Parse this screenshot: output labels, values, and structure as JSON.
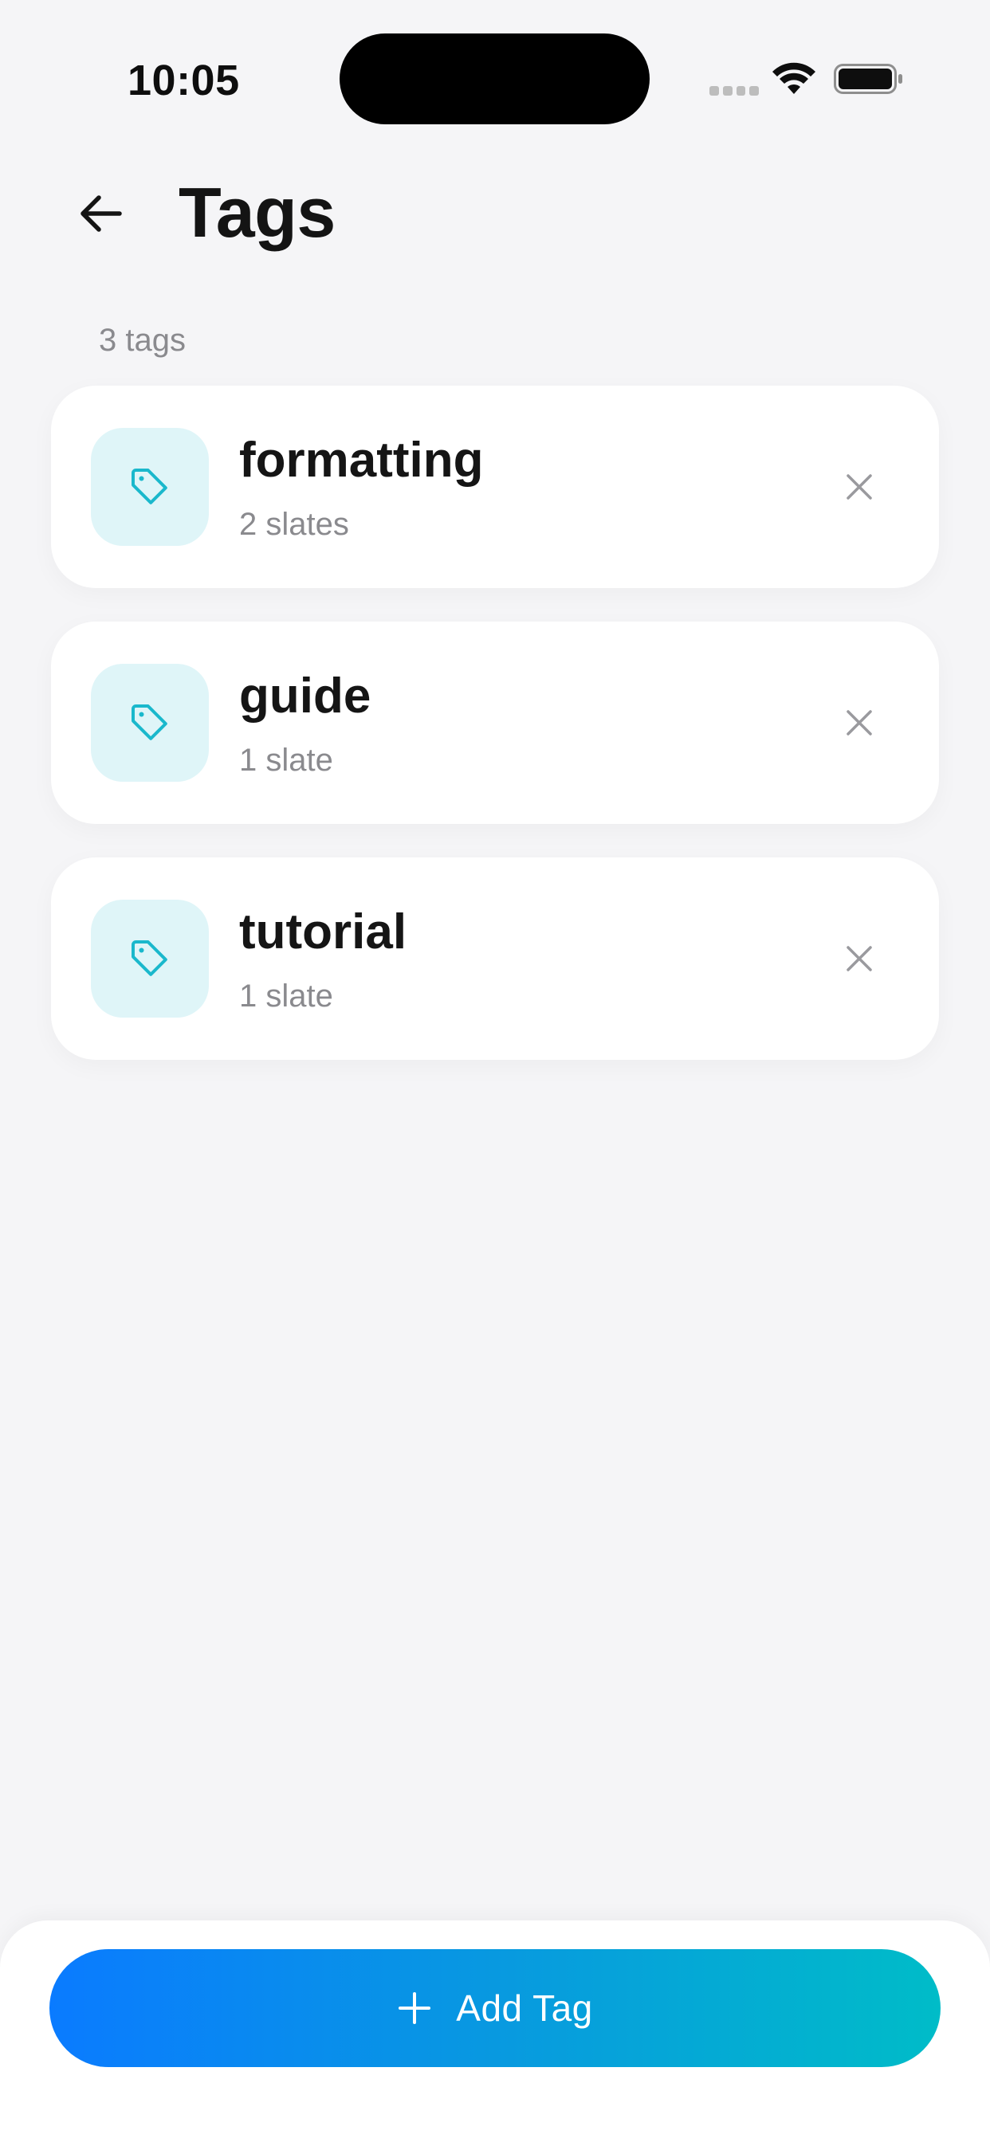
{
  "status_bar": {
    "time": "10:05"
  },
  "header": {
    "title": "Tags",
    "back_icon": "arrow-left-icon"
  },
  "summary": {
    "count_label": "3 tags"
  },
  "tags": [
    {
      "name": "formatting",
      "count_label": "2 slates"
    },
    {
      "name": "guide",
      "count_label": "1 slate"
    },
    {
      "name": "tutorial",
      "count_label": "1 slate"
    }
  ],
  "footer": {
    "add_label": "Add Tag",
    "add_icon": "plus-icon"
  },
  "colors": {
    "accent_start": "#0a7bff",
    "accent_end": "#00bcc8",
    "tag_icon": "#1ab8cc",
    "tag_icon_bg": "#dff5f8"
  }
}
